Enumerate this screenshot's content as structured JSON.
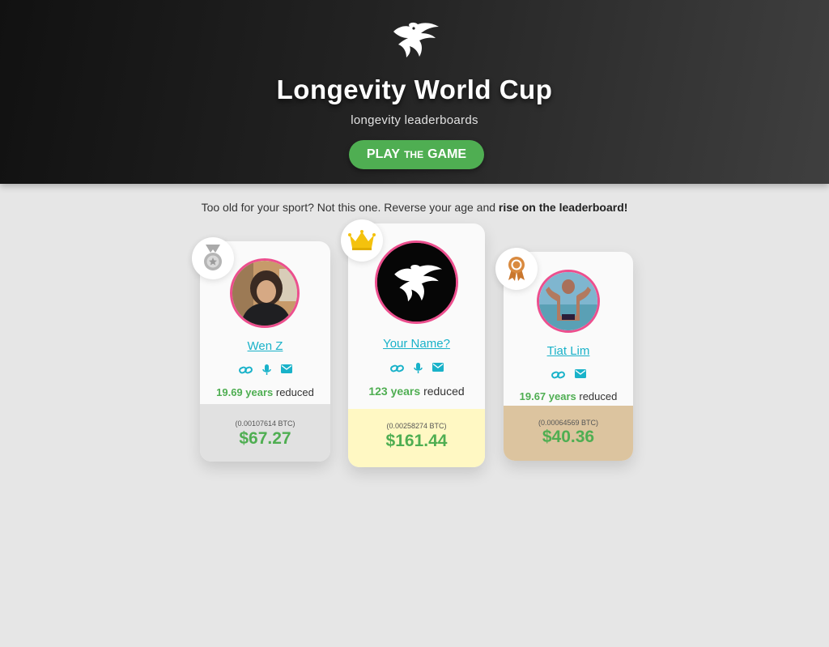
{
  "header": {
    "title": "Longevity World Cup",
    "subtitle": "longevity leaderboards",
    "play_button": {
      "word1": "PLAY",
      "word2": "THE",
      "word3": "GAME"
    }
  },
  "tagline": {
    "prefix": "Too old for your sport? Not this one. Reverse your age and ",
    "bold": "rise on the leaderboard!"
  },
  "podium": [
    {
      "rank_icon": "silver-medal-icon",
      "name": "Wen Z",
      "years": "19.69 years",
      "reduced_label": "reduced",
      "btc": "(0.00107614 BTC)",
      "usd": "$67.27",
      "links": [
        "link-icon",
        "microphone-icon",
        "email-icon"
      ],
      "bottom_color": "#e1e1e1"
    },
    {
      "rank_icon": "crown-icon",
      "name": "Your Name?",
      "years": "123 years",
      "reduced_label": "reduced",
      "btc": "(0.00258274 BTC)",
      "usd": "$161.44",
      "links": [
        "link-icon",
        "microphone-icon",
        "email-icon"
      ],
      "bottom_color": "#fff8c3"
    },
    {
      "rank_icon": "bronze-award-icon",
      "name": "Tiat Lim",
      "years": "19.67 years",
      "reduced_label": "reduced",
      "btc": "(0.00064569 BTC)",
      "usd": "$40.36",
      "links": [
        "link-icon",
        "email-icon"
      ],
      "bottom_color": "#dcc49f"
    }
  ],
  "colors": {
    "accent_green": "#4fae52",
    "link_teal": "#19b2c9",
    "avatar_ring": "#ec4f8e"
  }
}
